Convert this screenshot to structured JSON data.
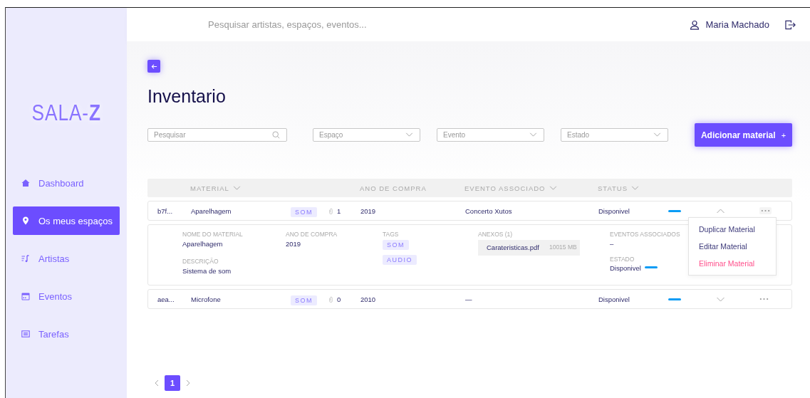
{
  "logo": "SALA-**Z**",
  "header": {
    "search_placeholder": "Pesquisar artistas, espaços, eventos...",
    "user": "Maria Machado"
  },
  "sidebar": {
    "items": [
      {
        "label": "Dashboard",
        "selected": false
      },
      {
        "label": "Os meus espaços",
        "selected": true
      },
      {
        "label": "Artistas",
        "selected": false
      },
      {
        "label": "Eventos",
        "selected": false
      },
      {
        "label": "Tarefas",
        "selected": false
      }
    ]
  },
  "title": "Inventario",
  "filters": [
    {
      "kind": "search",
      "placeholder": "Pesquisar"
    },
    {
      "kind": "select",
      "placeholder": "Espaço"
    },
    {
      "kind": "select",
      "placeholder": "Evento"
    },
    {
      "kind": "select",
      "placeholder": "Estado"
    }
  ],
  "add_button": {
    "label": "Adicionar material",
    "icon": "+"
  },
  "table": {
    "columns": [
      {
        "label": "MATERIAL",
        "sortable": true
      },
      {
        "label": "ANO DE COMPRA",
        "sortable": false
      },
      {
        "label": "EVENTO ASSOCIADO",
        "sortable": true
      },
      {
        "label": "STATUS",
        "sortable": true
      }
    ],
    "rows": [
      {
        "id": "b7f...",
        "material": "Aparelhagem",
        "tag": "SOM",
        "attachments": "1",
        "year": "2019",
        "event": "Concerto Xutos",
        "status": "Disponivel",
        "color": "#0a9cf5",
        "expanded": true,
        "menu_open": true,
        "details": {
          "name_label": "NOME DO MATERIAL",
          "name": "Aparelhagem",
          "description_label": "DESCRIÇÃO",
          "description": "Sistema de som",
          "year_label": "ANO DE COMPRA",
          "year": "2019",
          "tags_label": "TAGS",
          "tags": [
            "SOM",
            "AUDIO"
          ],
          "attachments_label": "ANEXOS (1)",
          "files": [
            {
              "name": "Carateristicas.pdf",
              "size": "10015 MB"
            }
          ],
          "events_label": "EVENTOS ASSOCIADOS",
          "events": "–",
          "state_label": "ESTADO",
          "state": "Disponivel"
        }
      },
      {
        "id": "aea...",
        "material": "Microfone",
        "tag": "SOM",
        "attachments": "0",
        "year": "2010",
        "event": "—",
        "status": "Disponivel",
        "color": "#0a9cf5",
        "expanded": false,
        "menu_open": false
      }
    ]
  },
  "menu": {
    "items": [
      {
        "label": "Duplicar Material",
        "kind": "normal"
      },
      {
        "label": "Editar Material",
        "kind": "normal"
      },
      {
        "label": "Eliminar Material",
        "kind": "danger"
      }
    ]
  },
  "pagination": {
    "pages": [
      {
        "label": "1",
        "selected": true
      }
    ]
  }
}
